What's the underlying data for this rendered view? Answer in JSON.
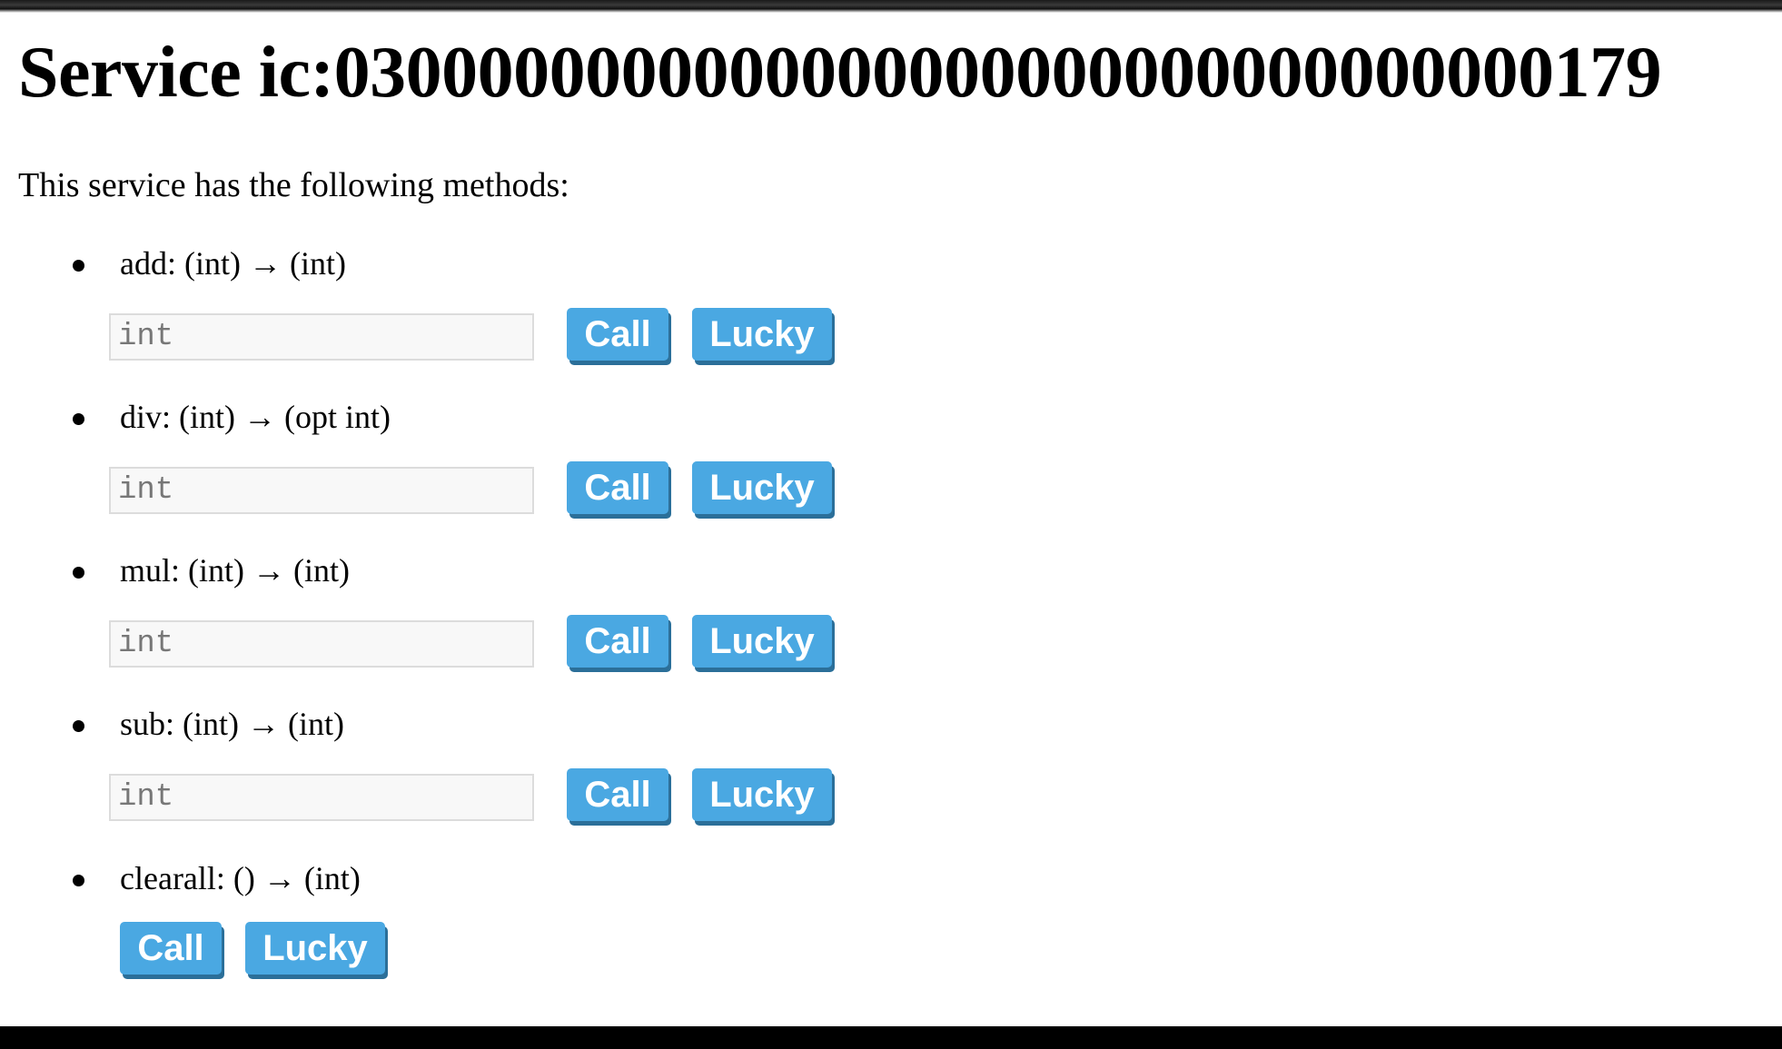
{
  "title": "Service ic:0300000000000000000000000000000000179",
  "intro": "This service has the following methods:",
  "methods": [
    {
      "signature": "add: (int) → (int)",
      "input_placeholder": "int",
      "call_label": "Call",
      "lucky_label": "Lucky"
    },
    {
      "signature": "div: (int) → (opt int)",
      "input_placeholder": "int",
      "call_label": "Call",
      "lucky_label": "Lucky"
    },
    {
      "signature": "mul: (int) → (int)",
      "input_placeholder": "int",
      "call_label": "Call",
      "lucky_label": "Lucky"
    },
    {
      "signature": "sub: (int) → (int)",
      "input_placeholder": "int",
      "call_label": "Call",
      "lucky_label": "Lucky"
    },
    {
      "signature": "clearall: () → (int)",
      "call_label": "Call",
      "lucky_label": "Lucky"
    }
  ],
  "colors": {
    "button_bg": "#4aa8e2",
    "button_shadow": "#2b6f99",
    "input_bg": "#f8f8f8"
  }
}
